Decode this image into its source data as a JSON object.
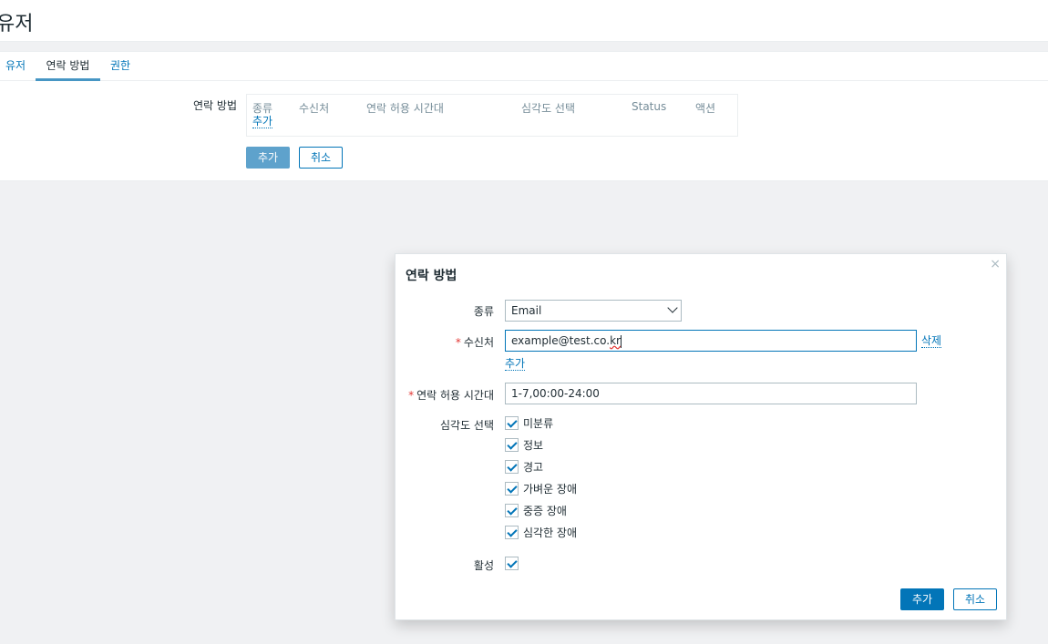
{
  "page": {
    "title": "유저"
  },
  "tabs": [
    {
      "label": "유저"
    },
    {
      "label": "연락 방법"
    },
    {
      "label": "권한"
    }
  ],
  "media_form": {
    "label": "연락 방법",
    "columns": [
      "종류",
      "수신처",
      "연락 허용 시간대",
      "심각도 선택",
      "Status",
      "액션"
    ],
    "add_link": "추가"
  },
  "form_buttons": {
    "add": "추가",
    "cancel": "취소"
  },
  "modal": {
    "title": "연락 방법",
    "close_icon": "×",
    "type_label": "종류",
    "type_value": "Email",
    "sendto_label": "수신처",
    "sendto_value_prefix": "example@test.co.",
    "sendto_value_suffix": "kr",
    "remove_link": "삭제",
    "add_link": "추가",
    "period_label": "연락 허용 시간대",
    "period_value": "1-7,00:00-24:00",
    "severity_label": "심각도 선택",
    "severities": [
      "미분류",
      "정보",
      "경고",
      "가벼운 장애",
      "중증 장애",
      "심각한 장애"
    ],
    "enabled_label": "활성",
    "add_button": "추가",
    "cancel_button": "취소",
    "required_mark": "*"
  }
}
